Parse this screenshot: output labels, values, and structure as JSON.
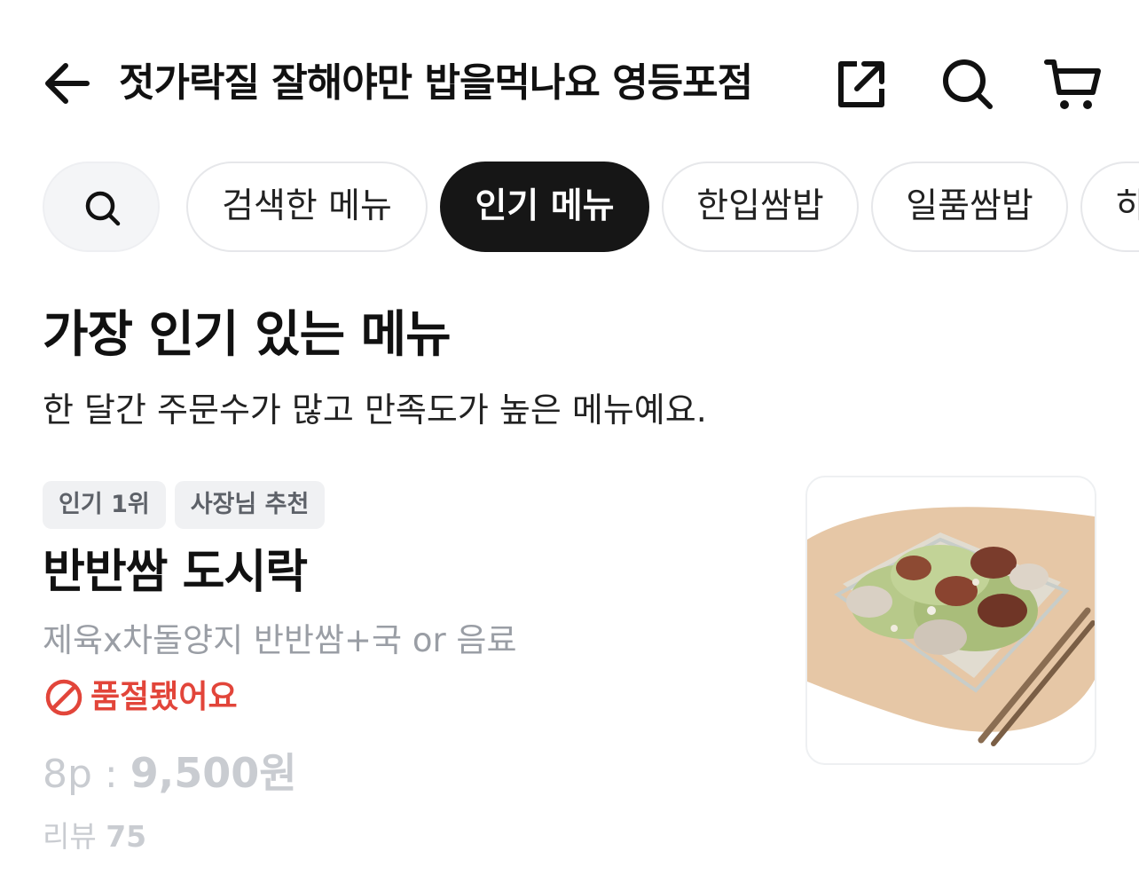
{
  "header": {
    "title": "젓가락질 잘해야만 밥을먹나요 영등포점",
    "back_icon": "arrow-left-icon",
    "share_icon": "share-external-icon",
    "search_icon": "search-icon",
    "cart_icon": "cart-icon"
  },
  "chips": {
    "search_icon": "search-icon",
    "items": [
      {
        "label": "검색한 메뉴",
        "active": false
      },
      {
        "label": "인기 메뉴",
        "active": true
      },
      {
        "label": "한입쌈밥",
        "active": false
      },
      {
        "label": "일품쌈밥",
        "active": false
      },
      {
        "label": "하",
        "active": false
      }
    ]
  },
  "section": {
    "title": "가장 인기 있는 메뉴",
    "subtitle": "한 달간 주문수가 많고 만족도가 높은 메뉴예요."
  },
  "menu_item": {
    "badges": [
      "인기 1위",
      "사장님 추천"
    ],
    "name": "반반쌈 도시락",
    "description": "제육x차돌양지 반반쌈+국 or 음료",
    "status": "품절됐어요",
    "price_label": "8p : ",
    "price": "9,500원",
    "review_label": "리뷰 ",
    "review_count": "75",
    "image": "food-photo-bossam-lunchbox"
  },
  "colors": {
    "accent_active": "#161616",
    "soldout_red": "#e2453a",
    "muted_text": "#9a9ea5",
    "disabled_text": "#c9ccd1",
    "badge_bg": "#f0f1f3"
  }
}
